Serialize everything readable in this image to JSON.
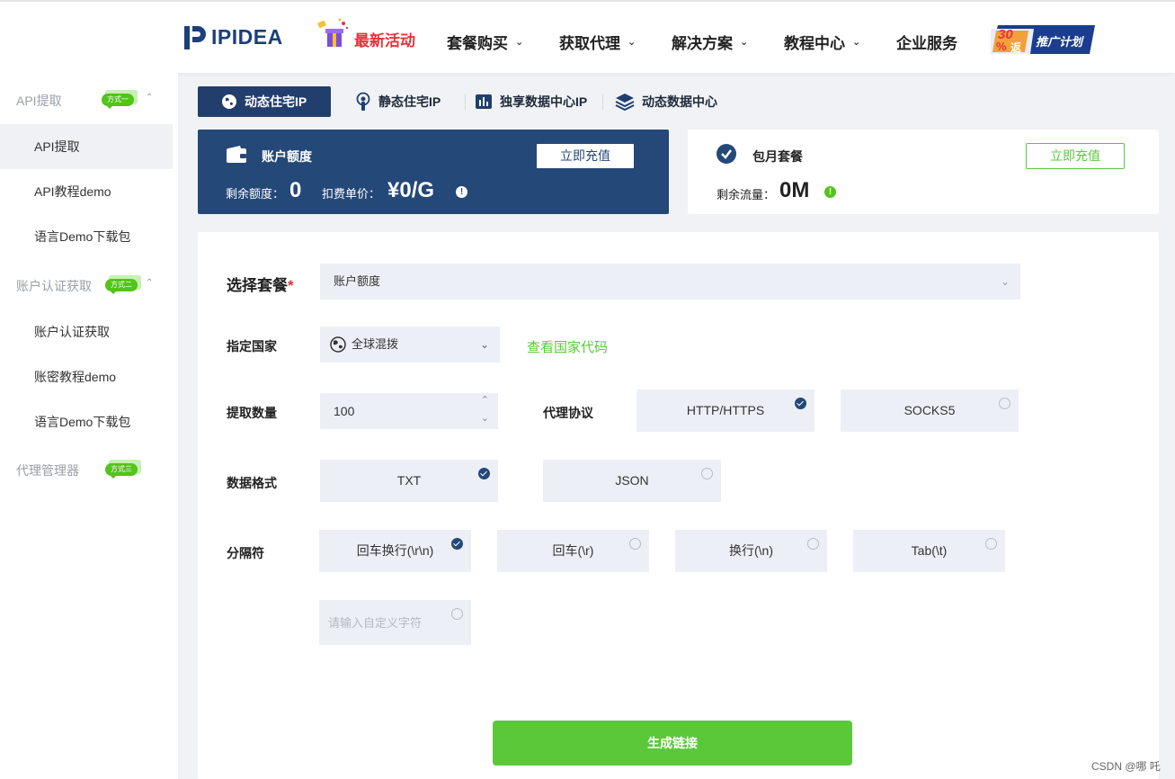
{
  "header": {
    "logo_text": "IPIDEA",
    "promo_label": "最新活动",
    "nav": [
      {
        "label": "套餐购买",
        "has_dropdown": true
      },
      {
        "label": "获取代理",
        "has_dropdown": true
      },
      {
        "label": "解决方案",
        "has_dropdown": true
      },
      {
        "label": "教程中心",
        "has_dropdown": true
      },
      {
        "label": "企业服务",
        "has_dropdown": false
      }
    ],
    "banner": {
      "badge_num": "30",
      "badge_pct": "%",
      "badge_fan": "返",
      "label": "推广计划"
    }
  },
  "sidebar": {
    "groups": [
      {
        "label": "API提取",
        "badge": "方式一",
        "items": [
          "API提取",
          "API教程demo",
          "语言Demo下载包"
        ]
      },
      {
        "label": "账户认证获取",
        "badge": "方式二",
        "items": [
          "账户认证获取",
          "账密教程demo",
          "语言Demo下载包"
        ]
      },
      {
        "label": "代理管理器",
        "badge": "方式三",
        "items": []
      }
    ],
    "active_item": "API提取"
  },
  "tabs": [
    {
      "label": "动态住宅IP",
      "icon": "globe-icon",
      "active": true
    },
    {
      "label": "静态住宅IP",
      "icon": "antenna-icon",
      "active": false
    },
    {
      "label": "独享数据中心IP",
      "icon": "bar-chart-icon",
      "active": false
    },
    {
      "label": "动态数据中心",
      "icon": "layers-icon",
      "active": false
    }
  ],
  "account_card": {
    "title": "账户额度",
    "recharge_label": "立即充值",
    "balance_label": "剩余额度：",
    "balance_value": "0",
    "unit_price_label": "扣费单价：",
    "unit_price_value": "¥0/G"
  },
  "monthly_card": {
    "title": "包月套餐",
    "recharge_label": "立即充值",
    "traffic_label": "剩余流量：",
    "traffic_value": "0M"
  },
  "form": {
    "package": {
      "label": "选择套餐",
      "required_mark": "*",
      "value": "账户额度"
    },
    "country": {
      "label": "指定国家",
      "value": "全球混拨",
      "link": "查看国家代码"
    },
    "quantity": {
      "label": "提取数量",
      "value": "100"
    },
    "protocol": {
      "label": "代理协议",
      "options": [
        {
          "label": "HTTP/HTTPS",
          "checked": true
        },
        {
          "label": "SOCKS5",
          "checked": false
        }
      ]
    },
    "format": {
      "label": "数据格式",
      "options": [
        {
          "label": "TXT",
          "checked": true
        },
        {
          "label": "JSON",
          "checked": false
        }
      ]
    },
    "separator": {
      "label": "分隔符",
      "options": [
        {
          "label": "回车换行(\\r\\n)",
          "checked": true
        },
        {
          "label": "回车(\\r)",
          "checked": false
        },
        {
          "label": "换行(\\n)",
          "checked": false
        },
        {
          "label": "Tab(\\t)",
          "checked": false
        }
      ],
      "custom_placeholder": "请输入自定义字符"
    },
    "generate_label": "生成链接"
  },
  "watermark": "CSDN @哪 吒",
  "colors": {
    "primary": "#244878",
    "green": "#5bc83a",
    "red": "#e8323c",
    "bg": "#f1f2f6"
  }
}
